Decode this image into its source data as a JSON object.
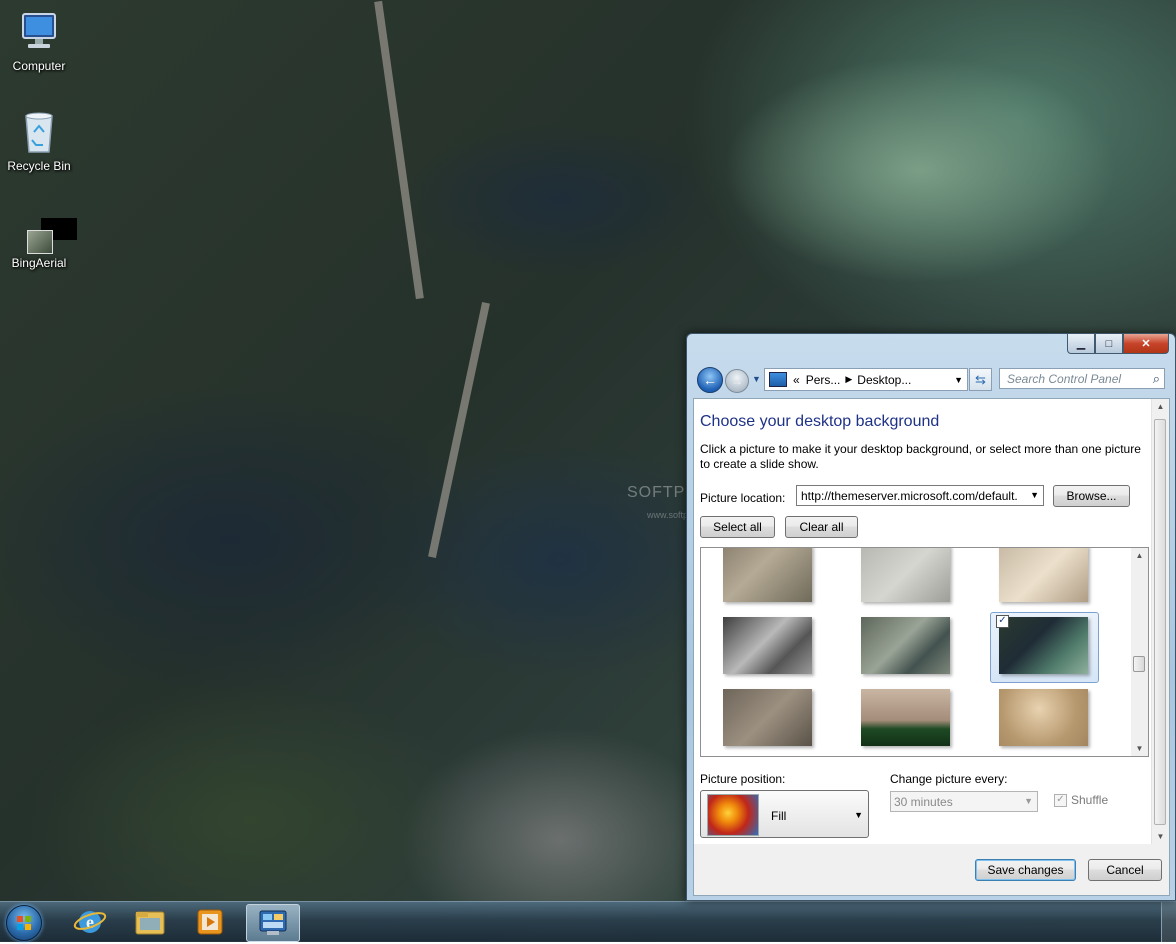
{
  "desktop": {
    "icons": [
      {
        "label": "Computer",
        "icon": "computer-icon"
      },
      {
        "label": "Recycle Bin",
        "icon": "recycle-bin-icon"
      },
      {
        "label": "BingAerial",
        "icon": "bing-aerial-icon"
      }
    ],
    "watermark": "SOFTPEDIA",
    "watermark_url": "www.softpedia.com"
  },
  "taskbar": {
    "items": [
      "start-orb",
      "internet-explorer-icon",
      "windows-explorer-icon",
      "media-player-icon",
      "control-panel-icon"
    ]
  },
  "window": {
    "caption": {
      "minimize": "▁",
      "maximize": "□",
      "close": "✕"
    },
    "address": {
      "prefix": "«",
      "crumb1": "Pers...",
      "crumb2": "Desktop..."
    },
    "search_placeholder": "Search Control Panel",
    "heading": "Choose your desktop background",
    "description": "Click a picture to make it your desktop background, or select more than one picture to create a slide show.",
    "picture_location_label": "Picture location:",
    "picture_location_value": "http://themeserver.microsoft.com/default.",
    "browse_label": "Browse...",
    "select_all_label": "Select all",
    "clear_all_label": "Clear all",
    "thumbnails_selected_index": 5,
    "picture_position_label": "Picture position:",
    "picture_position_value": "Fill",
    "change_picture_label": "Change picture every:",
    "change_picture_value": "30 minutes",
    "shuffle_label": "Shuffle",
    "save_label": "Save changes",
    "cancel_label": "Cancel",
    "colors": {
      "heading": "#1e3287",
      "close_button": "#c7442a"
    }
  }
}
